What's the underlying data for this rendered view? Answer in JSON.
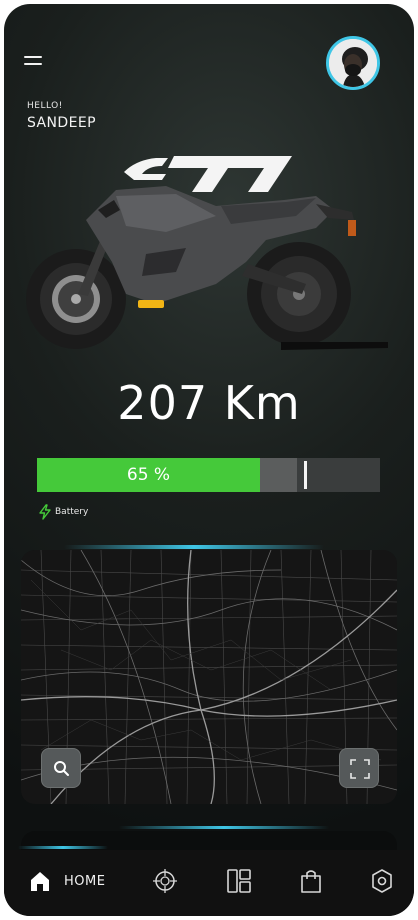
{
  "header": {
    "greeting": "HELLO!",
    "user_name": "SANDEEP"
  },
  "bike": {
    "badge_text": "F77",
    "accent_color": "#f2b515"
  },
  "status": {
    "range_text": "207 Km",
    "battery_percent": 65,
    "battery_percent_text": "65 %",
    "battery_label": "Battery",
    "battery_color": "#45c93a"
  },
  "map": {
    "search_icon": "search-icon",
    "expand_icon": "fullscreen-icon"
  },
  "tabbar": {
    "home_label": "HOME",
    "accent_color": "#3fc6e6",
    "icons": [
      "home-icon",
      "crosshair-icon",
      "dashboard-icon",
      "bag-icon",
      "settings-icon"
    ]
  }
}
